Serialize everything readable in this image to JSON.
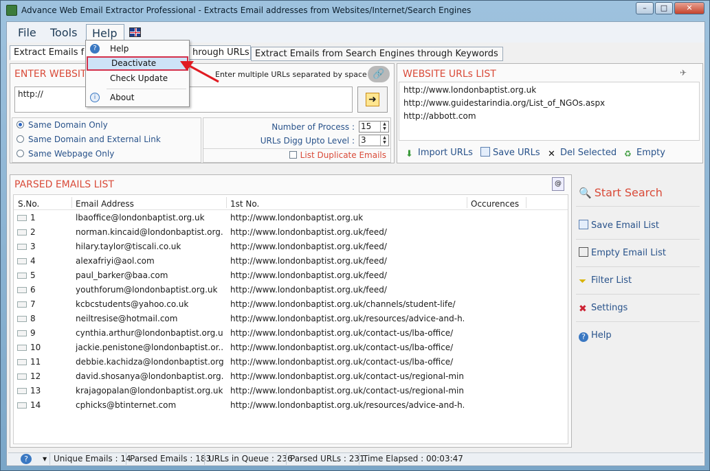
{
  "window": {
    "title": "Advance Web Email Extractor Professional - Extracts Email addresses from Websites/Internet/Search Engines"
  },
  "menu": {
    "file": "File",
    "tools": "Tools",
    "help": "Help"
  },
  "help_menu": {
    "items": [
      "Help",
      "Deactivate",
      "Check Update",
      "About"
    ],
    "selected": "Deactivate"
  },
  "tabs": [
    "Extract Emails f",
    "hrough URLs",
    "Extract Emails from Search Engines through Keywords"
  ],
  "enter_website": {
    "title": "ENTER WEBSIT",
    "hint": "Enter multiple URLs separated by space",
    "input_value": "http://"
  },
  "options": {
    "radios": [
      "Same Domain Only",
      "Same Domain and External Link",
      "Same Webpage Only"
    ],
    "selected_radio": "Same Domain Only",
    "number_of_process_label": "Number of Process :",
    "number_of_process": "15",
    "digg_level_label": "URLs Digg Upto Level :",
    "digg_level": "3",
    "list_duplicate": "List Duplicate Emails"
  },
  "website_urls": {
    "title": "WEBSITE URLs LIST",
    "urls": [
      "http://www.londonbaptist.org.uk",
      "http://www.guidestarindia.org/List_of_NGOs.aspx",
      "http://abbott.com"
    ],
    "import": "Import URLs",
    "save": "Save URLs",
    "del": "Del Selected",
    "empty": "Empty"
  },
  "parsed": {
    "title": "PARSED EMAILS LIST",
    "headers": [
      "S.No.",
      "Email Address",
      "1st No.",
      "Occurences"
    ],
    "rows": [
      [
        "1",
        "lbaoffice@londonbaptist.org.uk",
        "http://www.londonbaptist.org.uk"
      ],
      [
        "2",
        "norman.kincaid@londonbaptist.org....",
        "http://www.londonbaptist.org.uk/feed/"
      ],
      [
        "3",
        "hilary.taylor@tiscali.co.uk",
        "http://www.londonbaptist.org.uk/feed/"
      ],
      [
        "4",
        "alexafriyi@aol.com",
        "http://www.londonbaptist.org.uk/feed/"
      ],
      [
        "5",
        "paul_barker@baa.com",
        "http://www.londonbaptist.org.uk/feed/"
      ],
      [
        "6",
        "youthforum@londonbaptist.org.uk",
        "http://www.londonbaptist.org.uk/feed/"
      ],
      [
        "7",
        "kcbcstudents@yahoo.co.uk",
        "http://www.londonbaptist.org.uk/channels/student-life/"
      ],
      [
        "8",
        "neiltresise@hotmail.com",
        "http://www.londonbaptist.org.uk/resources/advice-and-h..."
      ],
      [
        "9",
        "cynthia.arthur@londonbaptist.org.uk",
        "http://www.londonbaptist.org.uk/contact-us/lba-office/"
      ],
      [
        "10",
        "jackie.penistone@londonbaptist.or....",
        "http://www.londonbaptist.org.uk/contact-us/lba-office/"
      ],
      [
        "11",
        "debbie.kachidza@londonbaptist.org....",
        "http://www.londonbaptist.org.uk/contact-us/lba-office/"
      ],
      [
        "12",
        "david.shosanya@londonbaptist.org....",
        "http://www.londonbaptist.org.uk/contact-us/regional-min..."
      ],
      [
        "13",
        "krajagopalan@londonbaptist.org.uk",
        "http://www.londonbaptist.org.uk/contact-us/regional-min..."
      ],
      [
        "14",
        "cphicks@btinternet.com",
        "http://www.londonbaptist.org.uk/resources/advice-and-h..."
      ]
    ]
  },
  "side": {
    "start": "Start Search",
    "save": "Save Email List",
    "empty": "Empty Email List",
    "filter": "Filter List",
    "settings": "Settings",
    "help": "Help"
  },
  "status": {
    "unique": "Unique Emails :  14",
    "parsed": "Parsed Emails :  183",
    "queue": "URLs in Queue :  236",
    "parsed_urls": "Parsed URLs :  231",
    "elapsed": "Time Elapsed :   00:03:47"
  },
  "colors": {
    "accent": "#d94a38",
    "link": "#28528a",
    "highlight": "#d32f4a"
  }
}
